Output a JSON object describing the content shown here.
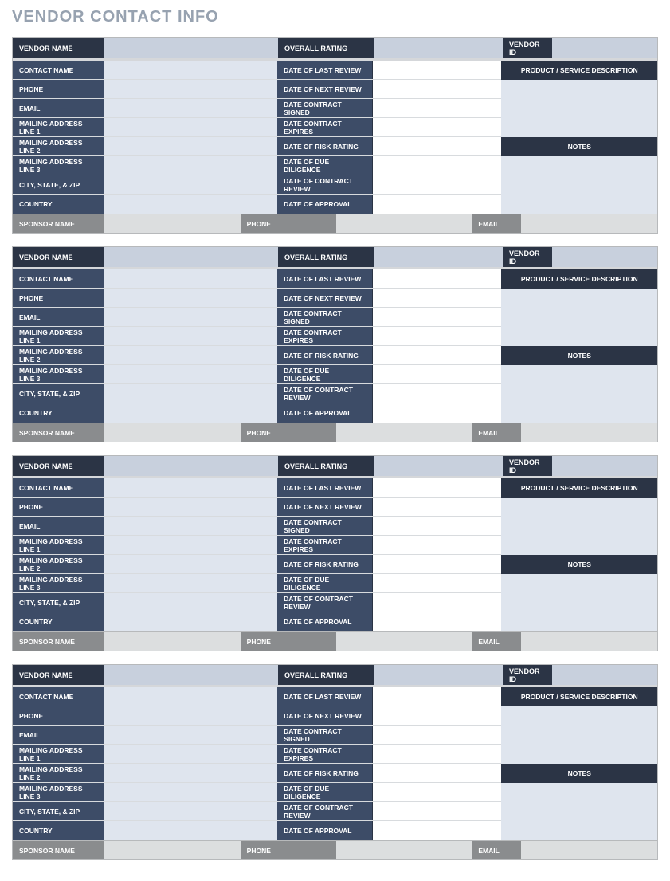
{
  "title": "VENDOR CONTACT INFO",
  "labels": {
    "vendor_name": "VENDOR NAME",
    "overall_rating": "OVERALL RATING",
    "vendor_id": "VENDOR ID",
    "contact_name": "CONTACT NAME",
    "phone": "PHONE",
    "email": "EMAIL",
    "addr1": "MAILING ADDRESS LINE 1",
    "addr2": "MAILING ADDRESS LINE 2",
    "addr3": "MAILING ADDRESS LINE 3",
    "csz": "CITY, STATE, & ZIP",
    "country": "COUNTRY",
    "date_last_review": "DATE OF LAST REVIEW",
    "date_next_review": "DATE OF NEXT REVIEW",
    "date_contract_signed": "DATE CONTRACT SIGNED",
    "date_contract_expires": "DATE CONTRACT EXPIRES",
    "date_risk_rating": "DATE OF RISK RATING",
    "date_due_diligence": "DATE OF DUE DILIGENCE",
    "date_contract_review": "DATE OF CONTRACT REVIEW",
    "date_approval": "DATE OF APPROVAL",
    "prod_desc": "PRODUCT / SERVICE DESCRIPTION",
    "notes": "NOTES",
    "sponsor_name": "SPONSOR NAME",
    "sponsor_phone": "PHONE",
    "sponsor_email": "EMAIL"
  },
  "cards": [
    {
      "vendor_name": "",
      "overall_rating": "",
      "vendor_id": "",
      "contact_name": "",
      "phone": "",
      "email": "",
      "addr1": "",
      "addr2": "",
      "addr3": "",
      "csz": "",
      "country": "",
      "date_last_review": "",
      "date_next_review": "",
      "date_contract_signed": "",
      "date_contract_expires": "",
      "date_risk_rating": "",
      "date_due_diligence": "",
      "date_contract_review": "",
      "date_approval": "",
      "prod_desc": "",
      "notes": "",
      "sponsor_name": "",
      "sponsor_phone": "",
      "sponsor_email": ""
    },
    {
      "vendor_name": "",
      "overall_rating": "",
      "vendor_id": "",
      "contact_name": "",
      "phone": "",
      "email": "",
      "addr1": "",
      "addr2": "",
      "addr3": "",
      "csz": "",
      "country": "",
      "date_last_review": "",
      "date_next_review": "",
      "date_contract_signed": "",
      "date_contract_expires": "",
      "date_risk_rating": "",
      "date_due_diligence": "",
      "date_contract_review": "",
      "date_approval": "",
      "prod_desc": "",
      "notes": "",
      "sponsor_name": "",
      "sponsor_phone": "",
      "sponsor_email": ""
    },
    {
      "vendor_name": "",
      "overall_rating": "",
      "vendor_id": "",
      "contact_name": "",
      "phone": "",
      "email": "",
      "addr1": "",
      "addr2": "",
      "addr3": "",
      "csz": "",
      "country": "",
      "date_last_review": "",
      "date_next_review": "",
      "date_contract_signed": "",
      "date_contract_expires": "",
      "date_risk_rating": "",
      "date_due_diligence": "",
      "date_contract_review": "",
      "date_approval": "",
      "prod_desc": "",
      "notes": "",
      "sponsor_name": "",
      "sponsor_phone": "",
      "sponsor_email": ""
    },
    {
      "vendor_name": "",
      "overall_rating": "",
      "vendor_id": "",
      "contact_name": "",
      "phone": "",
      "email": "",
      "addr1": "",
      "addr2": "",
      "addr3": "",
      "csz": "",
      "country": "",
      "date_last_review": "",
      "date_next_review": "",
      "date_contract_signed": "",
      "date_contract_expires": "",
      "date_risk_rating": "",
      "date_due_diligence": "",
      "date_contract_review": "",
      "date_approval": "",
      "prod_desc": "",
      "notes": "",
      "sponsor_name": "",
      "sponsor_phone": "",
      "sponsor_email": ""
    }
  ]
}
